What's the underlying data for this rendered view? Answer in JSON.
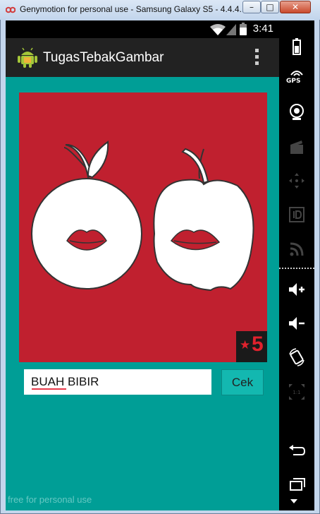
{
  "window": {
    "title": "Genymotion for personal use - Samsung Galaxy S5 - 4.4.4...",
    "controls": {
      "minimize": "–",
      "maximize": "□",
      "close": "✕"
    }
  },
  "statusbar": {
    "time": "3:41"
  },
  "actionbar": {
    "title": "TugasTebakGambar",
    "icon": "android-robot-icon"
  },
  "game": {
    "score": "5",
    "answer_value": "BUAH BIBIR",
    "check_button": "Cek"
  },
  "watermark": "free for personal use",
  "sidebar": {
    "gps_label": "GPS",
    "items": [
      "battery-icon",
      "gps-icon",
      "camera-icon",
      "clapper-icon",
      "dpad-icon",
      "id-icon",
      "rss-icon",
      "volume-up-icon",
      "volume-down-icon",
      "rotate-icon",
      "scale-icon",
      "back-icon",
      "recent-apps-icon"
    ]
  },
  "colors": {
    "screen_bg": "#009e96",
    "picture_bg": "#c0202f",
    "button_bg": "#13b8b0",
    "score_text": "#e0222d"
  }
}
